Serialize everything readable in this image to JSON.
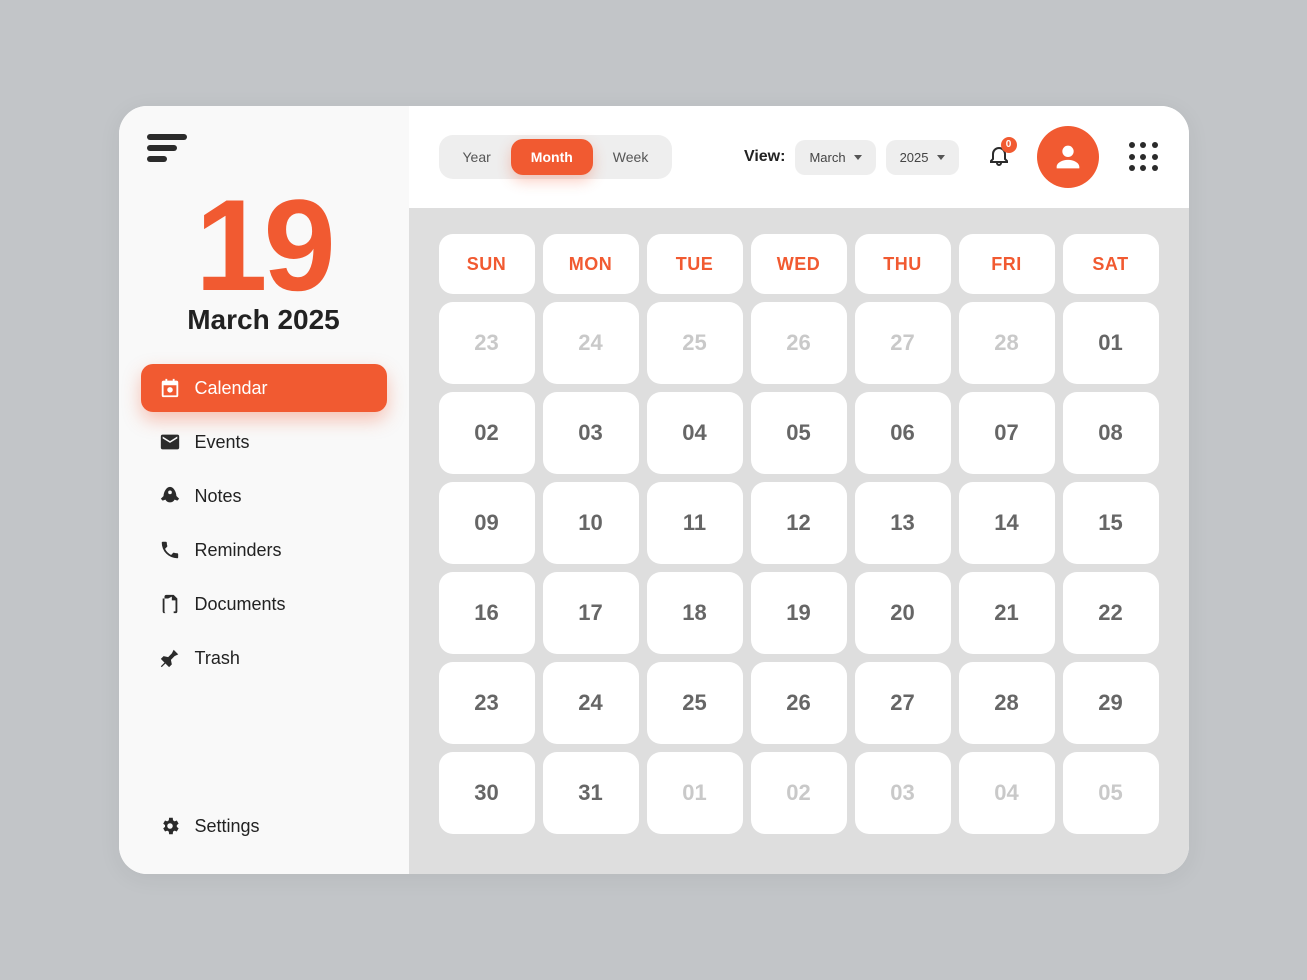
{
  "sidebar": {
    "current_day": "19",
    "month_year": "March 2025",
    "items": [
      {
        "label": "Calendar",
        "icon": "calendar",
        "active": true
      },
      {
        "label": "Events",
        "icon": "mail",
        "active": false
      },
      {
        "label": "Notes",
        "icon": "rocket",
        "active": false
      },
      {
        "label": "Reminders",
        "icon": "phone",
        "active": false
      },
      {
        "label": "Documents",
        "icon": "doc",
        "active": false
      },
      {
        "label": "Trash",
        "icon": "pin",
        "active": false
      }
    ],
    "settings_label": "Settings"
  },
  "topbar": {
    "segments": [
      {
        "label": "Year",
        "active": false
      },
      {
        "label": "Month",
        "active": true
      },
      {
        "label": "Week",
        "active": false
      }
    ],
    "view_label": "View:",
    "month_select": "March",
    "year_select": "2025",
    "notification_count": "0"
  },
  "calendar": {
    "weekdays": [
      "SUN",
      "MON",
      "TUE",
      "WED",
      "THU",
      "FRI",
      "SAT"
    ],
    "cells": [
      {
        "d": "23",
        "out": true
      },
      {
        "d": "24",
        "out": true
      },
      {
        "d": "25",
        "out": true
      },
      {
        "d": "26",
        "out": true
      },
      {
        "d": "27",
        "out": true
      },
      {
        "d": "28",
        "out": true
      },
      {
        "d": "01",
        "out": false
      },
      {
        "d": "02",
        "out": false
      },
      {
        "d": "03",
        "out": false
      },
      {
        "d": "04",
        "out": false
      },
      {
        "d": "05",
        "out": false
      },
      {
        "d": "06",
        "out": false
      },
      {
        "d": "07",
        "out": false
      },
      {
        "d": "08",
        "out": false
      },
      {
        "d": "09",
        "out": false
      },
      {
        "d": "10",
        "out": false
      },
      {
        "d": "11",
        "out": false
      },
      {
        "d": "12",
        "out": false
      },
      {
        "d": "13",
        "out": false
      },
      {
        "d": "14",
        "out": false
      },
      {
        "d": "15",
        "out": false
      },
      {
        "d": "16",
        "out": false
      },
      {
        "d": "17",
        "out": false
      },
      {
        "d": "18",
        "out": false
      },
      {
        "d": "19",
        "out": false
      },
      {
        "d": "20",
        "out": false
      },
      {
        "d": "21",
        "out": false
      },
      {
        "d": "22",
        "out": false
      },
      {
        "d": "23",
        "out": false
      },
      {
        "d": "24",
        "out": false
      },
      {
        "d": "25",
        "out": false
      },
      {
        "d": "26",
        "out": false
      },
      {
        "d": "27",
        "out": false
      },
      {
        "d": "28",
        "out": false
      },
      {
        "d": "29",
        "out": false
      },
      {
        "d": "30",
        "out": false
      },
      {
        "d": "31",
        "out": false
      },
      {
        "d": "01",
        "out": true
      },
      {
        "d": "02",
        "out": true
      },
      {
        "d": "03",
        "out": true
      },
      {
        "d": "04",
        "out": true
      },
      {
        "d": "05",
        "out": true
      }
    ]
  }
}
